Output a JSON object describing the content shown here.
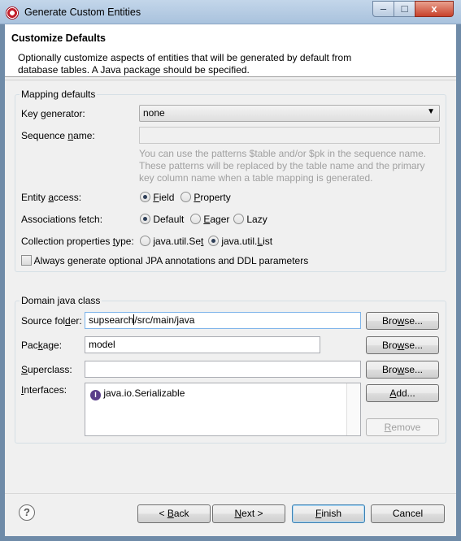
{
  "window": {
    "title": "Generate Custom Entities",
    "minimize": "–",
    "maximize": "□",
    "close": "x"
  },
  "header": {
    "title": "Customize Defaults",
    "description": "Optionally customize aspects of entities that will be generated by default from database tables. A Java package should be specified."
  },
  "mapping": {
    "group_title": "Mapping defaults",
    "key_generator": {
      "label_pre": "Key ",
      "label_u": "g",
      "label_post": "enerator:",
      "value": "none",
      "arrow": "▼"
    },
    "sequence_name": {
      "label_pre": "Sequence ",
      "label_u": "n",
      "label_post": "ame:",
      "value": ""
    },
    "sequence_hint": "You can use the patterns $table and/or $pk in the sequence name. These patterns will be replaced by the table name and the primary key column name when a table mapping is generated.",
    "entity_access": {
      "label_pre": "Entity ",
      "label_u": "a",
      "label_post": "ccess:",
      "field_u": "F",
      "field_post": "ield",
      "property_u": "P",
      "property_post": "roperty"
    },
    "associations_fetch": {
      "label_pre": "Associations fetch:",
      "default": "Default",
      "eager_u": "E",
      "eager_post": "ager",
      "lazy": "Lazy"
    },
    "collection_type": {
      "label_pre": "Collection properties ",
      "label_u": "t",
      "label_post": "ype:",
      "set_pre": "java.util.Se",
      "set_u": "t",
      "list_pre": "java.util.",
      "list_u": "L",
      "list_post": "ist"
    },
    "always_generate": "Always generate optional JPA annotations and DDL parameters"
  },
  "domain": {
    "group_title": "Domain java class",
    "source_folder": {
      "label_pre": "Source fol",
      "label_u": "d",
      "label_post": "er:",
      "value_pre": "supsearch",
      "value_post": "/src/main/java"
    },
    "package": {
      "label_pre": "Pac",
      "label_u": "k",
      "label_post": "age:",
      "value": "model"
    },
    "superclass": {
      "label_u": "S",
      "label_post": "uperclass:",
      "value": ""
    },
    "interfaces": {
      "label_u": "I",
      "label_post": "nterfaces:",
      "items": [
        "java.io.Serializable"
      ],
      "item_icon": "I"
    },
    "browse_pre": "Bro",
    "browse_u": "w",
    "browse_post": "se...",
    "add_u": "A",
    "add_post": "dd...",
    "remove_u": "R",
    "remove_post": "emove"
  },
  "footer": {
    "help": "?",
    "back_pre": "< ",
    "back_u": "B",
    "back_post": "ack",
    "next_u": "N",
    "next_post": "ext >",
    "finish_u": "F",
    "finish_post": "inish",
    "cancel": "Cancel"
  }
}
